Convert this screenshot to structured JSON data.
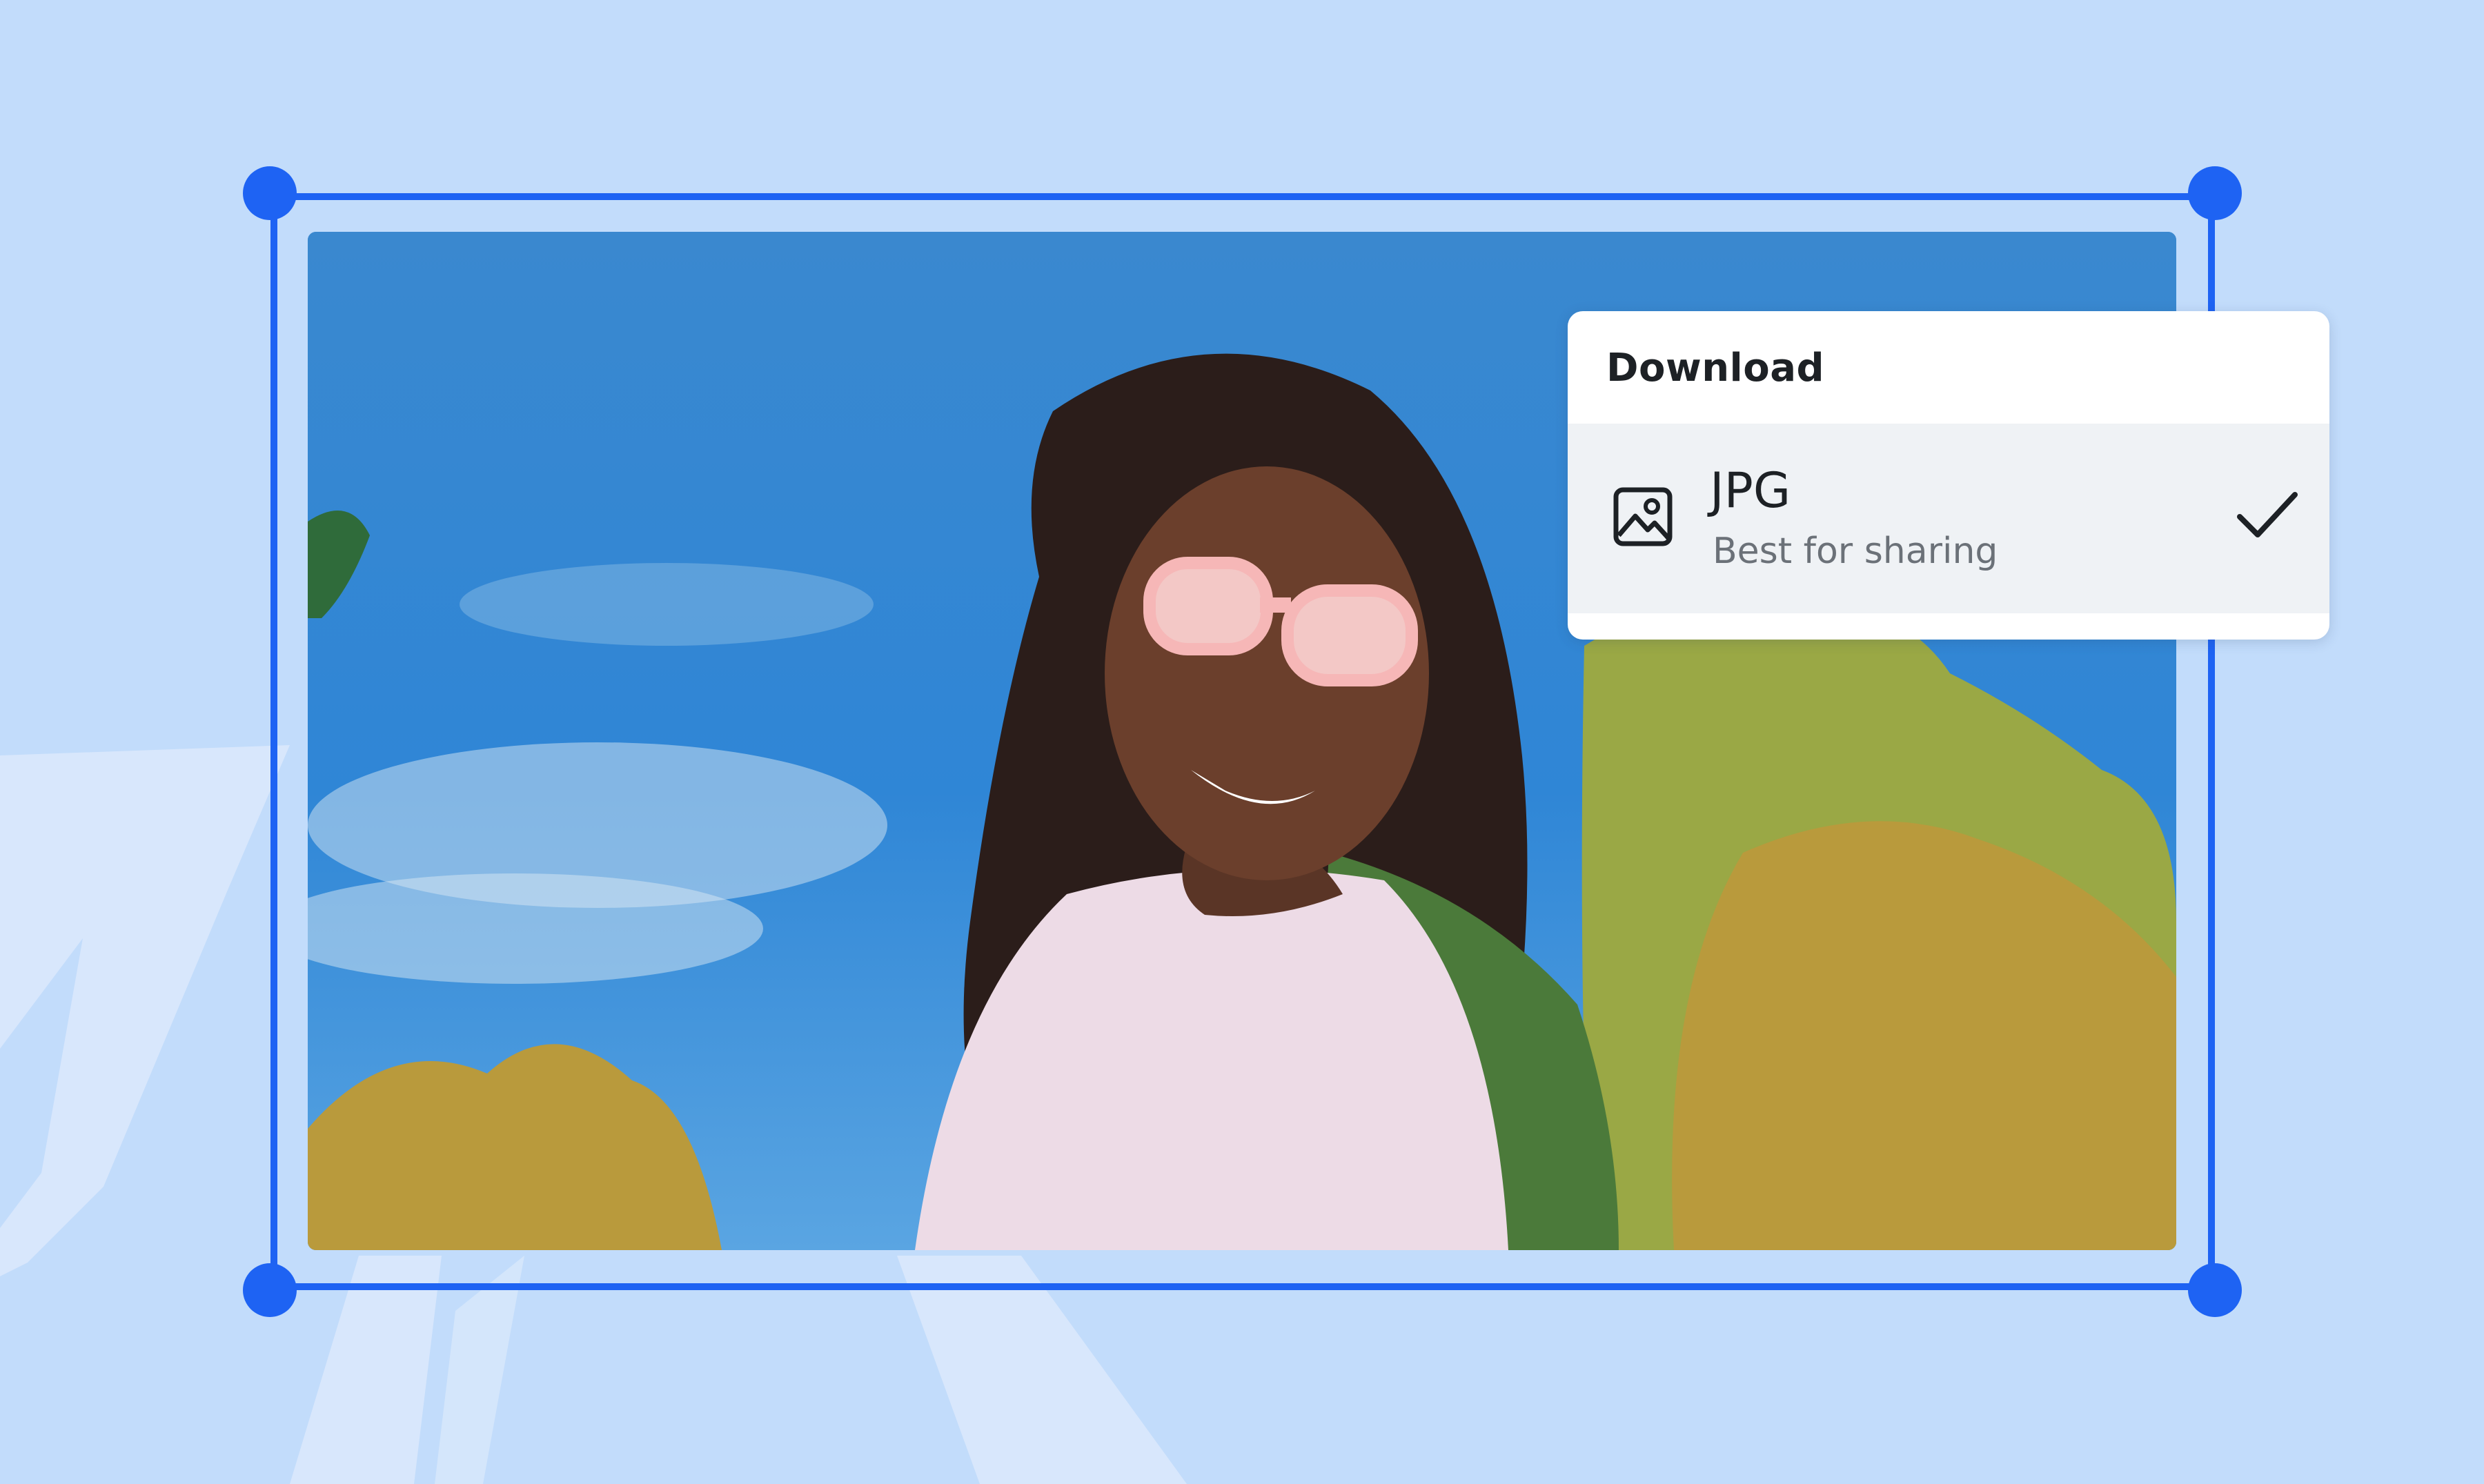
{
  "colors": {
    "background": "#c2dcfb",
    "selection": "#1e63f3",
    "panel": "#ffffff",
    "option_row": "#eff2f5",
    "text_primary": "#1d2125",
    "text_secondary": "#6b7178"
  },
  "canvas": {
    "image": {
      "description_icon": "photo-of-smiling-woman",
      "selected": true
    }
  },
  "download_panel": {
    "title": "Download",
    "options": [
      {
        "icon": "image-icon",
        "name": "JPG",
        "description": "Best for sharing",
        "selected": true,
        "selected_icon": "check-icon"
      }
    ]
  }
}
